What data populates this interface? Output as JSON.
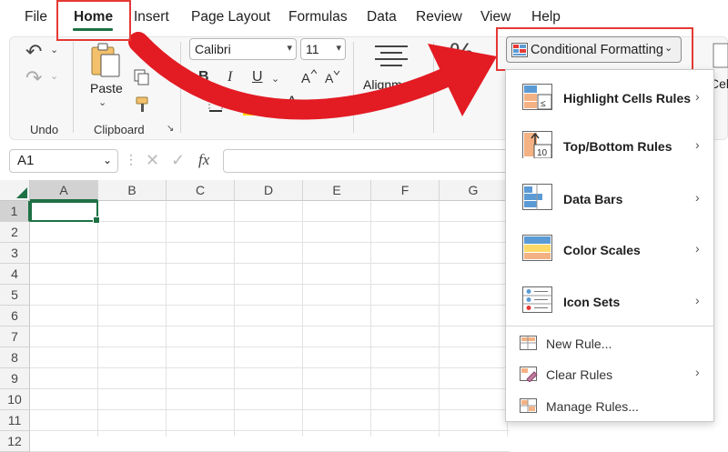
{
  "menu_tabs": {
    "file": "File",
    "home": "Home",
    "insert": "Insert",
    "page_layout": "Page Layout",
    "formulas": "Formulas",
    "data": "Data",
    "review": "Review",
    "view": "View",
    "help": "Help"
  },
  "ribbon": {
    "undo_group": "Undo",
    "clipboard_group": "Clipboard",
    "paste_label": "Paste",
    "font_name": "Calibri",
    "font_size": "11",
    "bold": "B",
    "italic": "I",
    "underline": "U",
    "font_color_letter": "A",
    "grow_font": "A^",
    "shrink_font": "A˅",
    "alignment_label": "Alignment",
    "number_symbol": "%",
    "conditional_formatting": "Conditional Formatting",
    "cell_styles_partial": "Cell"
  },
  "formula_bar": {
    "name_box": "A1",
    "fx": "fx"
  },
  "grid": {
    "columns": [
      "A",
      "B",
      "C",
      "D",
      "E",
      "F",
      "G"
    ],
    "rows": [
      "1",
      "2",
      "3",
      "4",
      "5",
      "6",
      "7",
      "8",
      "9",
      "10",
      "11",
      "12"
    ],
    "selected_cell": "A1"
  },
  "cf_menu": {
    "items": [
      {
        "label": "Highlight Cells Rules",
        "icon": "highlight-cells-icon",
        "has_submenu": true
      },
      {
        "label": "Top/Bottom Rules",
        "icon": "top-bottom-icon",
        "icon_text": "10",
        "has_submenu": true
      },
      {
        "label": "Data Bars",
        "icon": "data-bars-icon",
        "has_submenu": true
      },
      {
        "label": "Color Scales",
        "icon": "color-scales-icon",
        "has_submenu": true
      },
      {
        "label": "Icon Sets",
        "icon": "icon-sets-icon",
        "has_submenu": true
      }
    ],
    "secondary": [
      {
        "label": "New Rule...",
        "icon": "new-rule-icon",
        "has_submenu": false
      },
      {
        "label": "Clear Rules",
        "icon": "clear-rules-icon",
        "has_submenu": true
      },
      {
        "label": "Manage Rules...",
        "icon": "manage-rules-icon",
        "has_submenu": false
      }
    ]
  },
  "colors": {
    "excel_green": "#1e7145",
    "highlight_red": "#e53935",
    "cf_orange": "#f4b183",
    "cf_blue": "#5b9bd5"
  }
}
